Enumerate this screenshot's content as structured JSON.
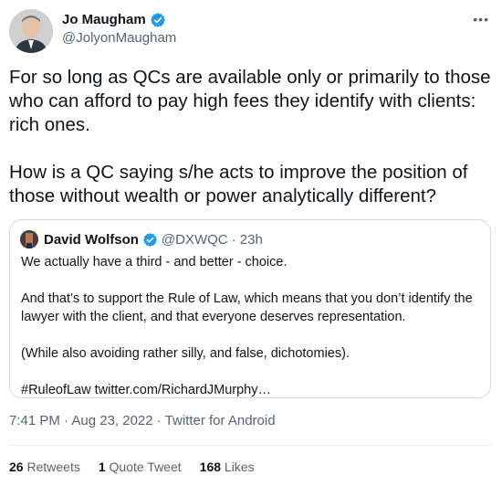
{
  "author": {
    "name": "Jo Maugham",
    "handle": "@JolyonMaugham",
    "verified_color": "#1d9bf0"
  },
  "tweet": {
    "text": "For so long as QCs are available only or primarily to those who can afford to pay high fees they identify with clients: rich ones.\n\nHow is a QC saying s/he acts to improve the position of those without wealth or power analytically different?"
  },
  "quote": {
    "name": "David Wolfson",
    "handle": "@DXWQC",
    "time": "· 23h",
    "text": "We actually have a third - and better - choice.\n\nAnd that’s to support the Rule of Law, which means that you don’t identify the lawyer with the client, and that everyone deserves representation.\n\n(While also avoiding rather silly, and false, dichotomies).\n\n#RuleofLaw twitter.com/RichardJMurphy…"
  },
  "meta": {
    "timestamp": "7:41 PM · Aug 23, 2022 · Twitter for Android"
  },
  "stats": {
    "retweets_count": "26",
    "retweets_label": "Retweets",
    "quotes_count": "1",
    "quotes_label": "Quote Tweet",
    "likes_count": "168",
    "likes_label": "Likes"
  },
  "icons": {
    "more": "more-options-icon",
    "verified": "verified-badge-icon"
  }
}
